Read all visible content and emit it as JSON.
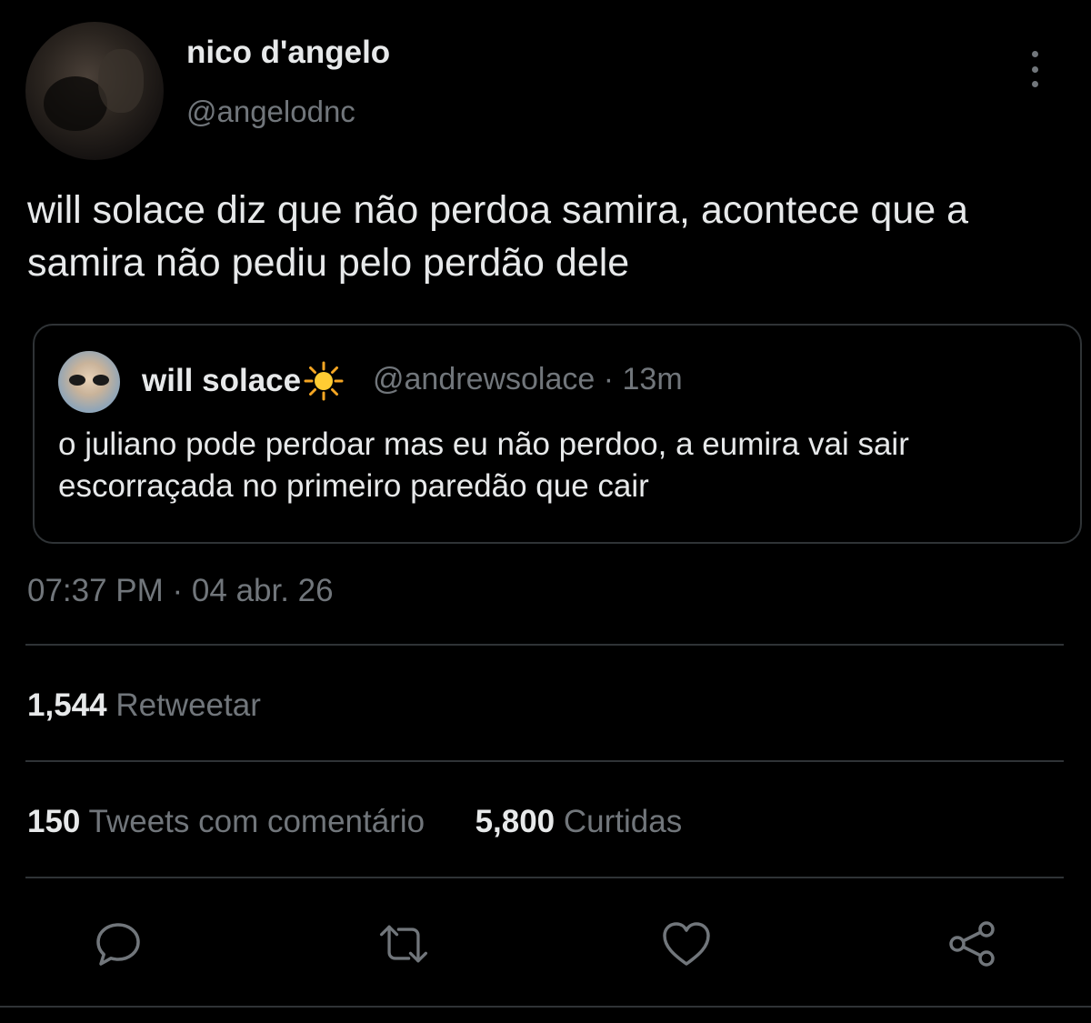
{
  "author": {
    "display_name": "nico d'angelo",
    "handle": "@angelodnc"
  },
  "tweet": {
    "text": "will solace diz que não perdoa samira, acontece que a samira não pediu pelo perdão dele",
    "time": "07:37 PM · 04 abr. 26"
  },
  "quoted": {
    "display_name": "will solace",
    "handle_time": "@andrewsolace · 13m",
    "text": "o juliano pode perdoar mas eu não perdoo, a eumira vai sair escorraçada no primeiro paredão que cair",
    "name_emoji_icon": "sun-icon"
  },
  "stats": {
    "retweets_count": "1,544",
    "retweets_label": "Retweetar",
    "quote_count": "150",
    "quote_label": "Tweets com comentário",
    "likes_count": "5,800",
    "likes_label": "Curtidas"
  },
  "actions": {
    "icons": [
      "reply-icon",
      "retweet-icon",
      "like-icon",
      "share-icon"
    ]
  },
  "colors": {
    "background": "#000000",
    "text": "#e7e9ea",
    "muted": "#71767b",
    "border": "#2f3336"
  }
}
